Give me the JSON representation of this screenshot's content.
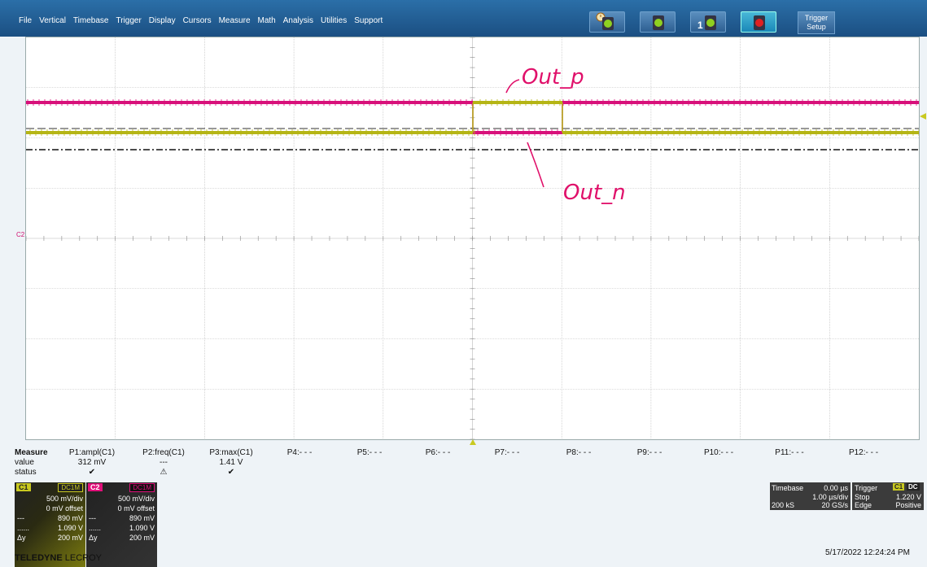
{
  "menu": [
    "File",
    "Vertical",
    "Timebase",
    "Trigger",
    "Display",
    "Cursors",
    "Measure",
    "Math",
    "Analysis",
    "Utilities",
    "Support"
  ],
  "toolbar": {
    "trigger_setup_line1": "Trigger",
    "trigger_setup_line2": "Setup",
    "single_label": "1"
  },
  "annotations": {
    "out_p": "Out_p",
    "out_n": "Out_n"
  },
  "screen": {
    "c2_label": "C2",
    "grid_color": "#b8b8b8",
    "c1_color": "#b5b515",
    "c2_color": "#d8107a"
  },
  "measure": {
    "header": "Measure",
    "row_labels": [
      "value",
      "status"
    ],
    "columns": [
      {
        "name": "P1:ampl(C1)",
        "value": "312 mV",
        "status": "✔"
      },
      {
        "name": "P2:freq(C1)",
        "value": "---",
        "status": "⚠"
      },
      {
        "name": "P3:max(C1)",
        "value": "1.41 V",
        "status": "✔"
      },
      {
        "name": "P4:- - -",
        "value": "",
        "status": ""
      },
      {
        "name": "P5:- - -",
        "value": "",
        "status": ""
      },
      {
        "name": "P6:- - -",
        "value": "",
        "status": ""
      },
      {
        "name": "P7:- - -",
        "value": "",
        "status": ""
      },
      {
        "name": "P8:- - -",
        "value": "",
        "status": ""
      },
      {
        "name": "P9:- - -",
        "value": "",
        "status": ""
      },
      {
        "name": "P10:- - -",
        "value": "",
        "status": ""
      },
      {
        "name": "P11:- - -",
        "value": "",
        "status": ""
      },
      {
        "name": "P12:- - -",
        "value": "",
        "status": ""
      }
    ]
  },
  "channels": {
    "c1": {
      "name": "C1",
      "coupling": "DC1M",
      "vdiv": "500 mV/div",
      "offset": "0 mV offset",
      "l1": "---",
      "v1": "890 mV",
      "l2": "......",
      "v2": "1.090 V",
      "l3": "Δy",
      "v3": "200 mV"
    },
    "c2": {
      "name": "C2",
      "coupling": "DC1M",
      "vdiv": "500 mV/div",
      "offset": "0 mV offset",
      "l1": "---",
      "v1": "890 mV",
      "l2": "......",
      "v2": "1.090 V",
      "l3": "Δy",
      "v3": "200 mV"
    }
  },
  "timebase": {
    "label": "Timebase",
    "delay": "0.00 µs",
    "tdiv": "1.00 µs/div",
    "samples": "200 kS",
    "rate": "20 GS/s"
  },
  "trigger": {
    "label": "Trigger",
    "source": "C1",
    "coupling": "DC",
    "mode": "Stop",
    "level": "1.220 V",
    "type": "Edge",
    "slope": "Positive"
  },
  "brand": {
    "a": "TELEDYNE",
    "b": "LECROY"
  },
  "timestamp": "5/17/2022 12:24:24 PM"
}
